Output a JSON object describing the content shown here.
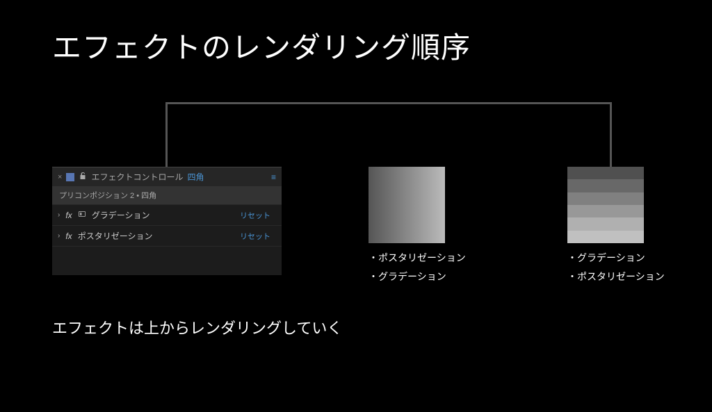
{
  "title": "エフェクトのレンダリング順序",
  "panel": {
    "tab_label": "エフェクトコントロール",
    "layer_name": "四角",
    "path": "プリコンポジション 2 • 四角",
    "effects": [
      {
        "name": "グラデーション",
        "reset": "リセット",
        "about": true
      },
      {
        "name": "ポスタリゼーション",
        "reset": "リセット",
        "about": false
      }
    ]
  },
  "preview_left": {
    "lines": [
      "・ポスタリゼーション",
      "・グラデーション"
    ]
  },
  "preview_right": {
    "lines": [
      "・グラデーション",
      "・ポスタリゼーション"
    ]
  },
  "footer": "エフェクトは上からレンダリングしていく"
}
